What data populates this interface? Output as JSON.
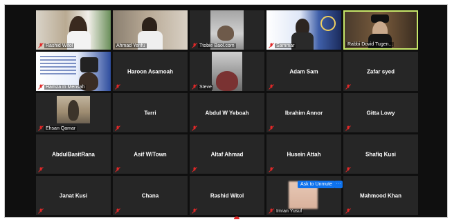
{
  "colors": {
    "background": "#0f0f0f",
    "tile": "#262626",
    "active_speaker_border": "#c7e86a",
    "muted_icon": "#e02828",
    "button_blue": "#0e72ed"
  },
  "participants": [
    {
      "name": "Rashid Witol",
      "video": true,
      "muted": true
    },
    {
      "name": "Ahmad Yenfu",
      "video": true,
      "muted": false
    },
    {
      "name": "Ttobie Baol.com",
      "video": true,
      "muted": true
    },
    {
      "name": "Sammar",
      "video": true,
      "muted": true
    },
    {
      "name": "Rabbi Dovid Tugen...",
      "video": true,
      "muted": false,
      "active": true
    },
    {
      "name": "Hamza in Mensah",
      "video": true,
      "muted": true
    },
    {
      "name": "Haroon Asamoah",
      "video": false,
      "muted": true
    },
    {
      "name": "Steve",
      "video": true,
      "muted": true
    },
    {
      "name": "Adam Sam",
      "video": false,
      "muted": true
    },
    {
      "name": "Zafar syed",
      "video": false,
      "muted": true
    },
    {
      "name": "Ehsan Qamar",
      "video": true,
      "muted": true
    },
    {
      "name": "Terri",
      "video": false,
      "muted": true
    },
    {
      "name": "Abdul W Yeboah",
      "video": false,
      "muted": true
    },
    {
      "name": "Ibrahim Annor",
      "video": false,
      "muted": true
    },
    {
      "name": "Gitta Lowy",
      "video": false,
      "muted": true
    },
    {
      "name": "AbdulBasitRana",
      "video": false,
      "muted": true
    },
    {
      "name": "Asif W/Town",
      "video": false,
      "muted": true
    },
    {
      "name": "Altaf Ahmad",
      "video": false,
      "muted": true
    },
    {
      "name": "Husein Attah",
      "video": false,
      "muted": true
    },
    {
      "name": "Shafiq Kusi",
      "video": false,
      "muted": true
    },
    {
      "name": "Janat Kusi",
      "video": false,
      "muted": true
    },
    {
      "name": "Chana",
      "video": false,
      "muted": true
    },
    {
      "name": "Rashid Witol",
      "video": false,
      "muted": true
    },
    {
      "name": "Imran Yusuf",
      "video": true,
      "muted": true
    },
    {
      "name": "Mahmood Khan",
      "video": false,
      "muted": true
    }
  ],
  "ask_to_unmute_label": "Ask to Unmute",
  "more_label": "···"
}
